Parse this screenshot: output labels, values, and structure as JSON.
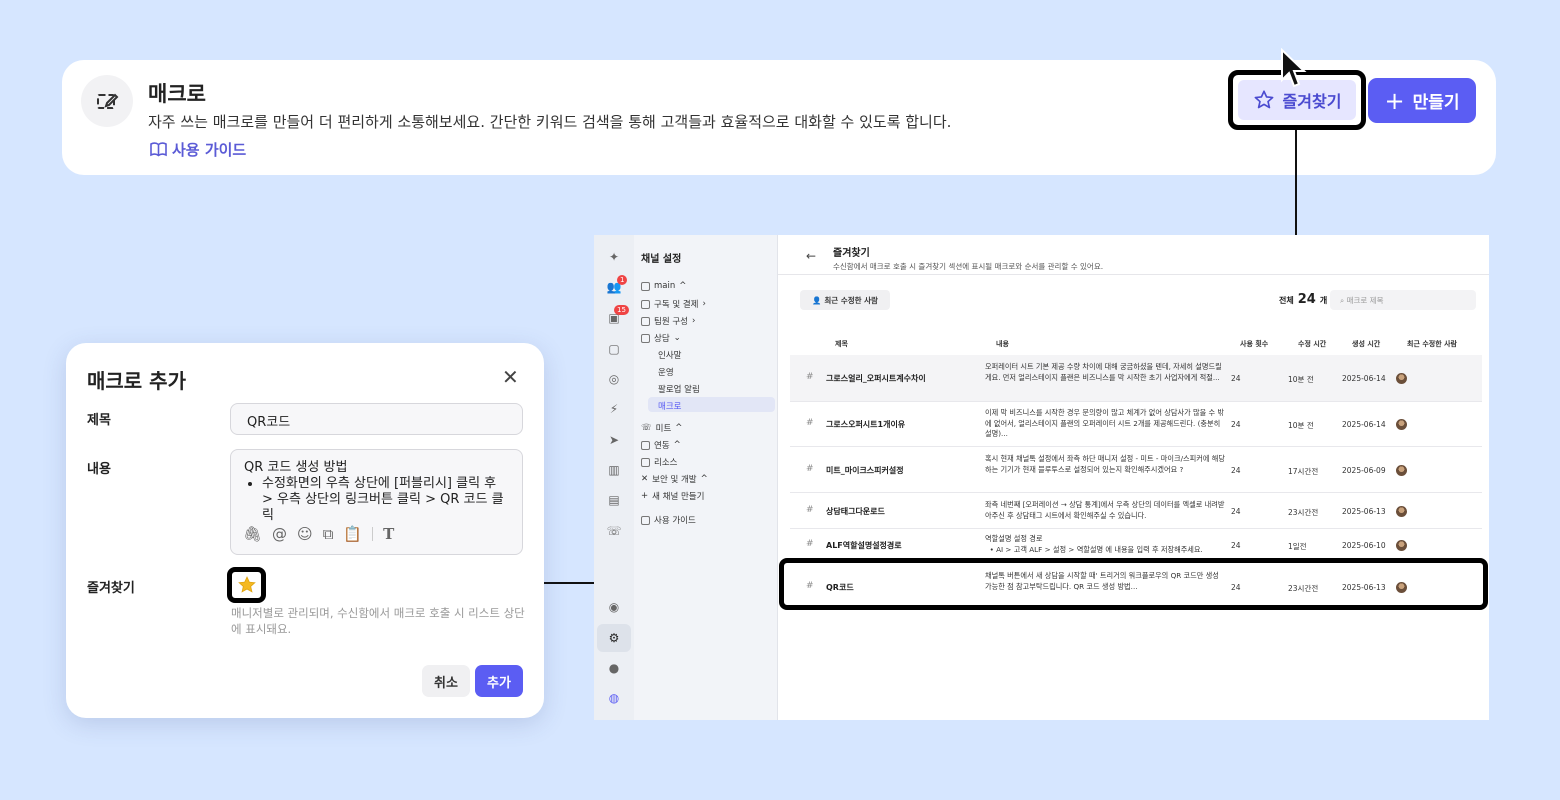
{
  "banner": {
    "title": "매크로",
    "description": "자주 쓰는 매크로를 만들어 더 편리하게 소통해보세요. 간단한 키워드 검색을 통해 고객들과 효율적으로 대화할 수 있도록 합니다.",
    "guide_link": "사용 가이드",
    "favorites_button": "즐겨찾기",
    "create_button": "만들기"
  },
  "dialog": {
    "title": "매크로 추가",
    "title_label": "제목",
    "title_value": "QR코드",
    "content_label": "내용",
    "content_line1": "QR 코드 생성 방법",
    "content_bullet": "수정화면의 우측 상단에 [퍼블리시] 클릭 후 > 우측 상단의 링크버튼 클릭 > QR 코드 클릭",
    "favorite_label": "즐겨찾기",
    "favorite_hint": "매니저별로 관리되며, 수신함에서 매크로 호출 시 리스트 상단에 표시돼요.",
    "cancel_button": "취소",
    "add_button": "추가"
  },
  "app": {
    "rail_badges": {
      "people": "1",
      "inbox": "15"
    },
    "sidebar": {
      "title": "채널 설정",
      "items": [
        "main",
        "구독 및 결제",
        "팀원 구성",
        "상담",
        "미트",
        "연동",
        "리소스",
        "보안 및 개발",
        "새 채널 만들기",
        "사용 가이드"
      ],
      "sub_items": [
        "인사말",
        "운영",
        "팔로업 알림",
        "매크로"
      ]
    },
    "main": {
      "title": "즐겨찾기",
      "subtitle": "수신함에서 매크로 호출 시 즐겨찾기 섹션에 표시될 매크로와 순서를 관리할 수 있어요.",
      "filter_button": "최근 수정한 사람",
      "total_label": "전체",
      "total_count": "24",
      "total_unit": "개",
      "search_placeholder": "매크로 제목",
      "columns": [
        "제목",
        "내용",
        "사용 횟수",
        "수정 시간",
        "생성 시간",
        "최근 수정한 사람"
      ],
      "rows": [
        {
          "name": "그로스얼리_오퍼시트계수차이",
          "desc": "오퍼레이터 시트 기본 제공 수량 차이에 대해 궁금하셨을 텐데, 자세히 설명드릴게요. 먼저 얼리스테이지 플랜은 비즈니스를 막 시작한 초기 사업자에게 적절...",
          "uses": "24",
          "modified": "10분 전",
          "created": "2025-06-14"
        },
        {
          "name": "그로스오퍼시트1개이유",
          "desc": "이제 막 비즈니스를 시작한 경우 문의량이 많고 체계가 없어 상담사가 많을 수 밖에 없어서, 얼리스테이지 플랜의 오퍼레이터 시트 2개를 제공해드린다. (충분히 설명)...",
          "uses": "24",
          "modified": "10분 전",
          "created": "2025-06-14"
        },
        {
          "name": "미트_마이크스피커설정",
          "desc": "혹시 현재 채널톡 설정에서 좌측 하단 매니저 설정 - 미트 - 마이크/스피커에 해당하는 기기가 현재 블루투스로 설정되어 있는지 확인해주시겠어요 ?",
          "uses": "24",
          "modified": "17시간전",
          "created": "2025-06-09"
        },
        {
          "name": "상담태그다운로드",
          "desc": "좌측 네번째 [오퍼레이션 → 상담 통계]에서 우측 상단의 데이터를 엑셀로 내려받아주신 후 상담태그 시트에서 확인해주실 수 있습니다.",
          "uses": "24",
          "modified": "23시간전",
          "created": "2025-06-13"
        },
        {
          "name": "ALF역할설명설정경로",
          "desc": "역할설명 설정 경로",
          "desc_bullet": "AI > 고객 ALF > 설정 > 역할설명 에 내용을 입력 후 저장해주세요.",
          "uses": "24",
          "modified": "1일전",
          "created": "2025-06-10"
        },
        {
          "name": "QR코드",
          "desc": "채널톡 버튼에서 새 상담을 시작할 때' 트리거의 워크플로우의 QR 코드만 생성 가능한 점 참고부탁드립니다. QR 코드 생성 방법...",
          "uses": "24",
          "modified": "23시간전",
          "created": "2025-06-13"
        }
      ]
    }
  },
  "colors": {
    "accent": "#5b5df3",
    "background": "#d6e6ff",
    "star": "#f5b921"
  }
}
